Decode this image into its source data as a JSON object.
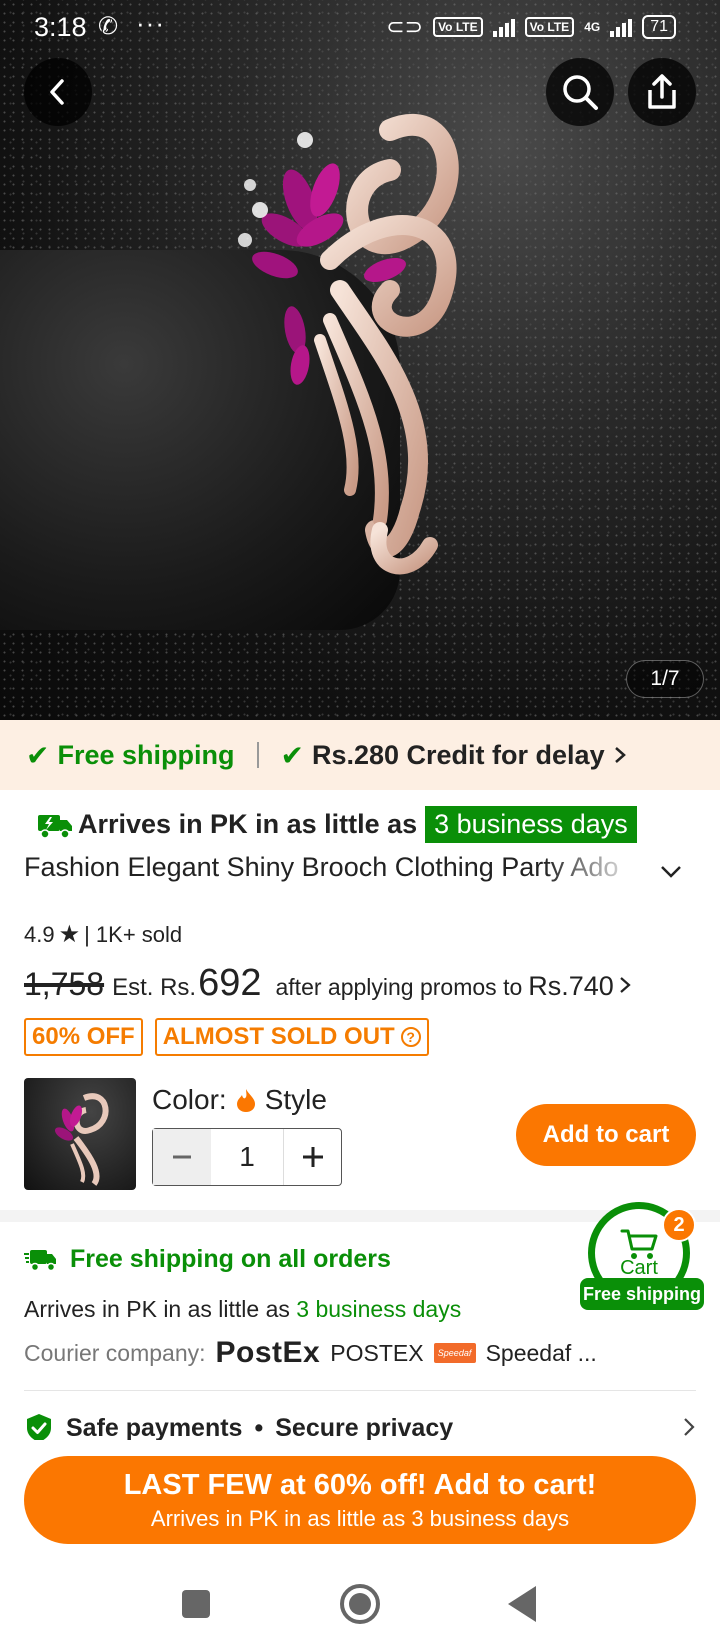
{
  "status_bar": {
    "time": "3:18",
    "network_1": "Vo LTE",
    "network_2": "Vo LTE",
    "network_type": "4G",
    "battery": "71"
  },
  "gallery": {
    "page_indicator": "1/7"
  },
  "promo_strip": {
    "free_shipping": "Free shipping",
    "credit": "Rs.280 Credit for delay"
  },
  "product": {
    "arrives_prefix": "Arrives in PK in as little as",
    "arrives_days": "3 business days",
    "title": "Fashion Elegant Shiny Brooch Clothing Party Ado",
    "rating": "4.9",
    "sold": "| 1K+ sold",
    "old_price": "1,758",
    "est_label": "Est. Rs.",
    "est_price": "692",
    "after_promos": "after applying promos to",
    "promo_price": "Rs.740",
    "tag_discount": "60% OFF",
    "tag_stock": "ALMOST SOLD OUT"
  },
  "sku": {
    "color_label": "Color:",
    "color_value": "Style",
    "quantity": "1",
    "add_to_cart": "Add to cart"
  },
  "shipping": {
    "headline": "Free shipping on all orders",
    "arrives_prefix": "Arrives in PK in as little as",
    "arrives_days": "3 business days",
    "courier_label": "Courier company:",
    "courier_logo_1": "PostEx",
    "courier_name_1": "POSTEX",
    "courier_logo_2": "Speedaf",
    "courier_name_2": "Speedaf ..."
  },
  "safety": {
    "safe_payments": "Safe payments",
    "secure_privacy": "Secure privacy"
  },
  "floating_cart": {
    "label": "Cart",
    "count": "2",
    "badge": "Free shipping"
  },
  "cta": {
    "line1": "LAST FEW at 60% off! Add to cart!",
    "line2": "Arrives in PK in as little as 3 business days"
  },
  "colors": {
    "accent_orange": "#fb7701",
    "green": "#0a8f08",
    "promo_bg": "#fdefe3"
  }
}
